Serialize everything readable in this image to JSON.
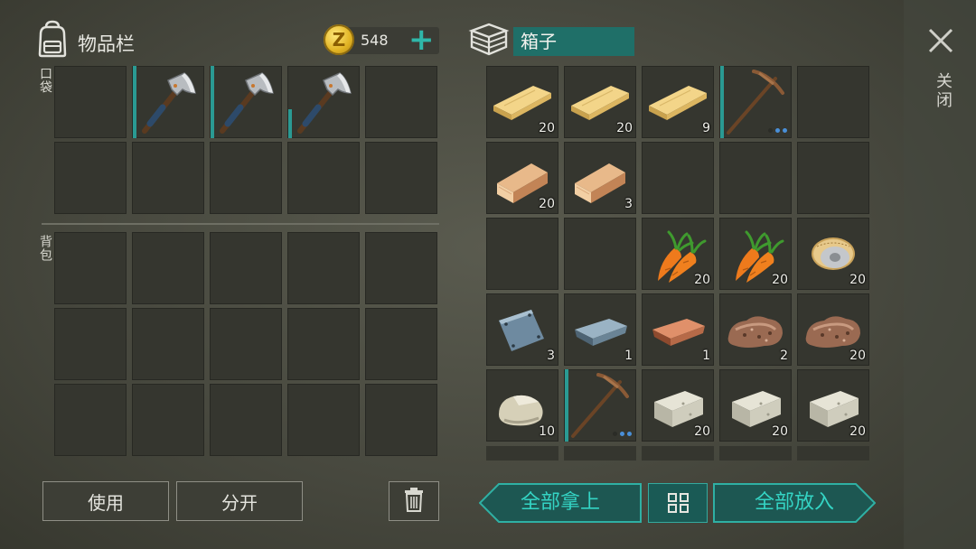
{
  "header": {
    "inventory_title": "物品栏",
    "coins": "548",
    "add_coins_label": "+",
    "chest_title": "箱子"
  },
  "inventory": {
    "pocket_label": "口袋",
    "backpack_label": "背包",
    "pocket_slots": [
      {
        "item": "",
        "count": ""
      },
      {
        "item": "hatchet",
        "count": "",
        "durability": 1.0
      },
      {
        "item": "hatchet",
        "count": "",
        "durability": 1.0
      },
      {
        "item": "hatchet",
        "count": "",
        "durability": 0.4
      },
      {
        "item": "",
        "count": ""
      },
      {
        "item": "",
        "count": ""
      },
      {
        "item": "",
        "count": ""
      },
      {
        "item": "",
        "count": ""
      },
      {
        "item": "",
        "count": ""
      },
      {
        "item": "",
        "count": ""
      }
    ],
    "backpack_slot_count": 15
  },
  "chest": {
    "slots": [
      {
        "item": "wood-plank",
        "count": "20"
      },
      {
        "item": "wood-plank",
        "count": "20"
      },
      {
        "item": "wood-plank",
        "count": "9"
      },
      {
        "item": "pickaxe",
        "count": "",
        "durability": 1.0,
        "dots": 3,
        "dots_on": 1
      },
      {
        "item": "",
        "count": ""
      },
      {
        "item": "wood-log",
        "count": "20"
      },
      {
        "item": "wood-log",
        "count": "3"
      },
      {
        "item": "",
        "count": ""
      },
      {
        "item": "",
        "count": ""
      },
      {
        "item": "",
        "count": ""
      },
      {
        "item": "",
        "count": ""
      },
      {
        "item": "",
        "count": ""
      },
      {
        "item": "carrot",
        "count": "20"
      },
      {
        "item": "carrot",
        "count": "20"
      },
      {
        "item": "wire-spool",
        "count": "20"
      },
      {
        "item": "metal-plate",
        "count": "3"
      },
      {
        "item": "iron-ingot",
        "count": "1"
      },
      {
        "item": "copper-ingot",
        "count": "1"
      },
      {
        "item": "iron-ore",
        "count": "2"
      },
      {
        "item": "iron-ore",
        "count": "20"
      },
      {
        "item": "stone",
        "count": "10"
      },
      {
        "item": "pickaxe",
        "count": "",
        "durability": 1.0,
        "dots": 3,
        "dots_on": 1
      },
      {
        "item": "limestone",
        "count": "20"
      },
      {
        "item": "limestone",
        "count": "20"
      },
      {
        "item": "limestone",
        "count": "20"
      }
    ]
  },
  "actions": {
    "use_label": "使用",
    "split_label": "分开",
    "take_all_label": "全部拿上",
    "put_all_label": "全部放入",
    "close_label": "关闭"
  },
  "colors": {
    "accent": "#34d4c4",
    "chest_title_bg": "#1f6f68",
    "slot_bg": "#35362f"
  }
}
